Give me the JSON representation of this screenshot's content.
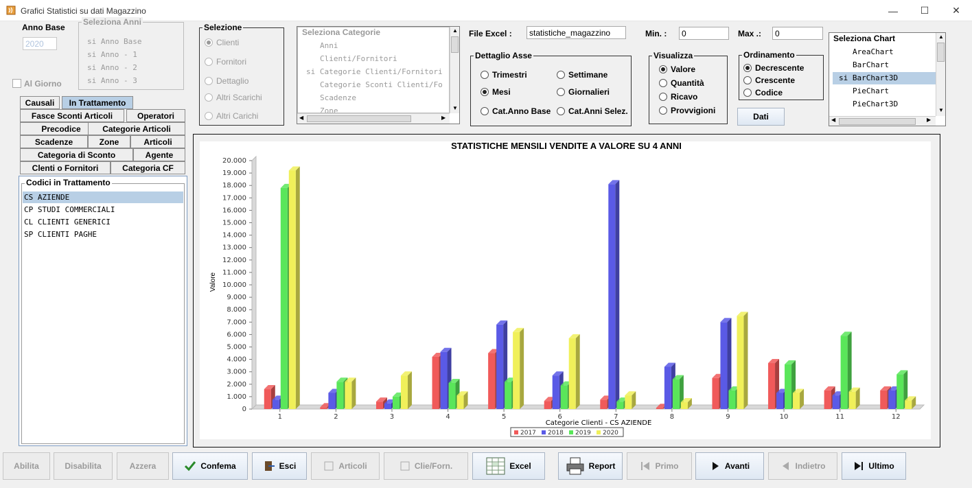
{
  "window": {
    "title": "Grafici Statistici su dati Magazzino",
    "minimize": "—",
    "maximize": "☐",
    "close": "✕"
  },
  "anno_base": {
    "label": "Anno Base",
    "value": "2020"
  },
  "al_giorno": {
    "label": "Al Giorno",
    "checked": false
  },
  "seleziona_anni": {
    "legend": "Seleziona Anni",
    "items": [
      "si Anno Base",
      "si Anno - 1",
      "si Anno - 2",
      "si Anno - 3"
    ]
  },
  "selezione": {
    "legend": "Selezione",
    "options": [
      "Clienti",
      "Fornitori",
      "Dettaglio",
      "Altri Scarichi",
      "Altri Carichi"
    ],
    "selected": 0
  },
  "seleziona_categorie": {
    "legend": "Seleziona Categorie",
    "items": [
      "Anni",
      "Clienti/Fornitori",
      "si Categorie Clienti/Fornitori",
      "Categorie Sconti Clienti/Fo",
      "Scadenze",
      "Zone"
    ]
  },
  "file_excel": {
    "label": "File Excel :",
    "value": "statistiche_magazzino"
  },
  "min": {
    "label": "Min. :",
    "value": "0"
  },
  "max": {
    "label": "Max .:",
    "value": "0"
  },
  "dettaglio_asse": {
    "legend": "Dettaglio Asse",
    "options": [
      "Trimestri",
      "Settimane",
      "Mesi",
      "Giornalieri",
      "Cat.Anno Base",
      "Cat.Anni Selez."
    ],
    "selected": 2
  },
  "visualizza": {
    "legend": "Visualizza",
    "options": [
      "Valore",
      "Quantità",
      "Ricavo",
      "Provvigioni"
    ],
    "selected": 0
  },
  "ordinamento": {
    "legend": "Ordinamento",
    "options": [
      "Decrescente",
      "Crescente",
      "Codice"
    ],
    "selected": 0
  },
  "dati_button": "Dati",
  "seleziona_chart": {
    "legend": "Seleziona Chart",
    "items": [
      "AreaChart",
      "BarChart",
      "si BarChart3D",
      "PieChart",
      "PieChart3D"
    ],
    "selected": 2
  },
  "tabs": {
    "causali": "Causali",
    "in_trattamento": "In Trattamento",
    "fasce_sconti": "Fasce Sconti Articoli",
    "operatori": "Operatori",
    "precodice": "Precodice",
    "categorie_articoli": "Categorie Articoli",
    "scadenze": "Scadenze",
    "zone": "Zone",
    "articoli": "Articoli",
    "categoria_sconto": "Categoria di Sconto",
    "agente": "Agente",
    "clienti_fornitori": "Clenti o Fornitori",
    "categoria_cf": "Categoria CF"
  },
  "codici": {
    "legend": "Codici in Trattamento",
    "items": [
      "CS AZIENDE",
      "CP STUDI COMMERCIALI",
      "CL CLIENTI GENERICI",
      "SP CLIENTI PAGHE"
    ],
    "selected": 0
  },
  "buttons": {
    "abilita": "Abilita",
    "disabilita": "Disabilita",
    "azzera": "Azzera",
    "conferma": "Confema",
    "esci": "Esci",
    "articoli": "Articoli",
    "clie_forn": "Clie/Forn.",
    "excel": "Excel",
    "report": "Report",
    "primo": "Primo",
    "avanti": "Avanti",
    "indietro": "Indietro",
    "ultimo": "Ultimo"
  },
  "chart_data": {
    "type": "bar",
    "title": "STATISTICHE MENSILI VENDITE A VALORE SU 4 ANNI",
    "xlabel": "Categorie Clienti - CS AZIENDE",
    "ylabel": "Valore",
    "ylim": [
      0,
      20000
    ],
    "yticks": [
      "0",
      "1.000",
      "2.000",
      "3.000",
      "4.000",
      "5.000",
      "6.000",
      "7.000",
      "8.000",
      "9.000",
      "10.000",
      "11.000",
      "12.000",
      "13.000",
      "14.000",
      "15.000",
      "16.000",
      "17.000",
      "18.000",
      "19.000",
      "20.000"
    ],
    "categories": [
      "1",
      "2",
      "3",
      "4",
      "5",
      "6",
      "7",
      "8",
      "9",
      "10",
      "11",
      "12"
    ],
    "series": [
      {
        "name": "2017",
        "color": "#f05a5a",
        "values": [
          1600,
          150,
          600,
          4200,
          4500,
          650,
          750,
          100,
          2500,
          3700,
          1500,
          1500
        ]
      },
      {
        "name": "2018",
        "color": "#5a5ae6",
        "values": [
          750,
          1300,
          450,
          4600,
          6800,
          2700,
          18100,
          3400,
          7000,
          1300,
          1100,
          1500
        ]
      },
      {
        "name": "2019",
        "color": "#5ae65a",
        "values": [
          17800,
          2200,
          1000,
          2100,
          2200,
          1900,
          600,
          2400,
          1500,
          3600,
          5900,
          2800
        ]
      },
      {
        "name": "2020",
        "color": "#f0f05a",
        "values": [
          19200,
          2200,
          2700,
          1100,
          6200,
          5700,
          1100,
          550,
          7500,
          1300,
          1400,
          700
        ]
      }
    ],
    "legend": "bottom",
    "grid": false
  }
}
